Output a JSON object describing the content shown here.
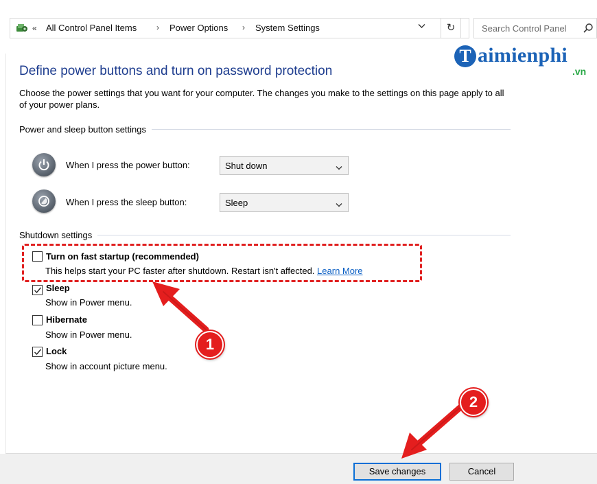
{
  "address_bar": {
    "breadcrumbs": [
      "All Control Panel Items",
      "Power Options",
      "System Settings"
    ],
    "search_placeholder": "Search Control Panel"
  },
  "watermark": {
    "logo_letter": "T",
    "name": "aimienphi",
    "tld": ".vn"
  },
  "page": {
    "title": "Define power buttons and turn on password protection",
    "description": "Choose the power settings that you want for your computer. The changes you make to the settings on this page apply to all of your power plans."
  },
  "power_sleep": {
    "section_label": "Power and sleep button settings",
    "power_button_label": "When I press the power button:",
    "power_button_value": "Shut down",
    "sleep_button_label": "When I press the sleep button:",
    "sleep_button_value": "Sleep"
  },
  "shutdown": {
    "section_label": "Shutdown settings",
    "items": [
      {
        "label": "Turn on fast startup (recommended)",
        "description": "This helps start your PC faster after shutdown. Restart isn't affected.",
        "link": "Learn More",
        "checked": false
      },
      {
        "label": "Sleep",
        "description": "Show in Power menu.",
        "checked": true
      },
      {
        "label": "Hibernate",
        "description": "Show in Power menu.",
        "checked": false
      },
      {
        "label": "Lock",
        "description": "Show in account picture menu.",
        "checked": true
      }
    ]
  },
  "footer": {
    "save_label": "Save changes",
    "cancel_label": "Cancel"
  },
  "annotations": {
    "badge1": "1",
    "badge2": "2"
  },
  "colors": {
    "title": "#1e3d8f",
    "link": "#0b5fc4",
    "annotation_red": "#e41e1e",
    "watermark_blue": "#1c63b7",
    "watermark_green": "#28a845"
  },
  "icons": [
    "control-panel-icon",
    "chevron-left-icon",
    "breadcrumb-chevron-icon",
    "dropdown-chevron-icon",
    "refresh-icon",
    "search-icon",
    "power-button-icon",
    "sleep-button-icon",
    "checkmark-icon"
  ]
}
